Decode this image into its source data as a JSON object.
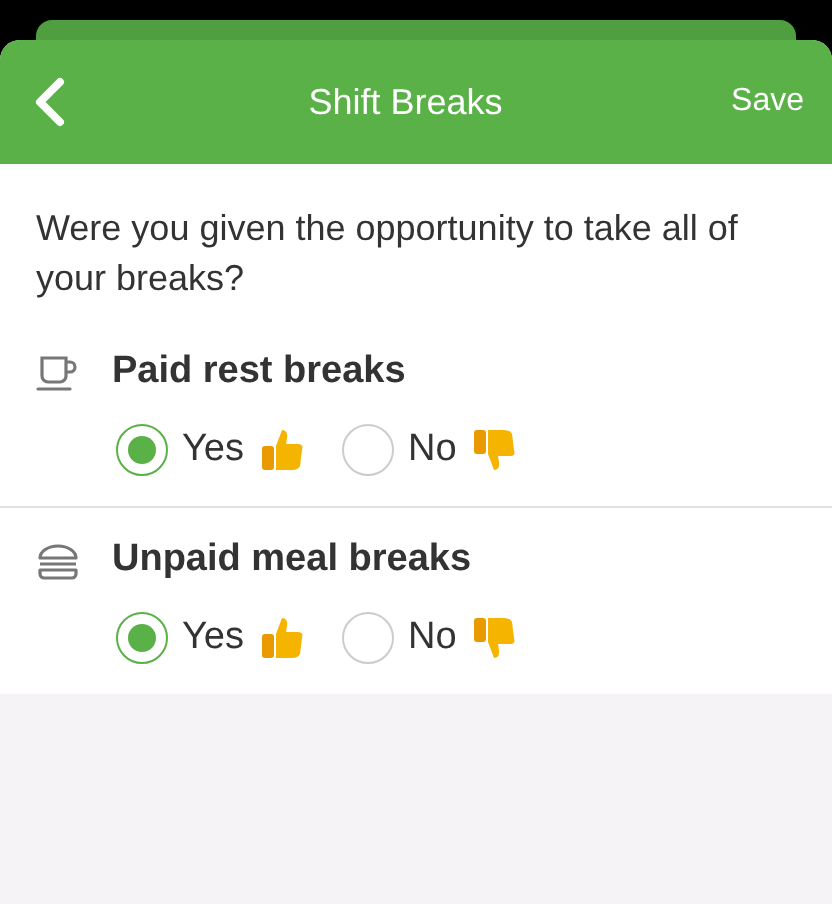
{
  "header": {
    "title": "Shift Breaks",
    "action": "Save"
  },
  "question": "Were you given the opportunity to take all of your breaks?",
  "sections": [
    {
      "kind": "cup",
      "title": "Paid rest breaks",
      "options": [
        {
          "label": "Yes",
          "kind": "up",
          "selected": true
        },
        {
          "label": "No",
          "kind": "down",
          "selected": false
        }
      ]
    },
    {
      "kind": "burger",
      "title": "Unpaid meal breaks",
      "options": [
        {
          "label": "Yes",
          "kind": "up",
          "selected": true
        },
        {
          "label": "No",
          "kind": "down",
          "selected": false
        }
      ]
    }
  ]
}
